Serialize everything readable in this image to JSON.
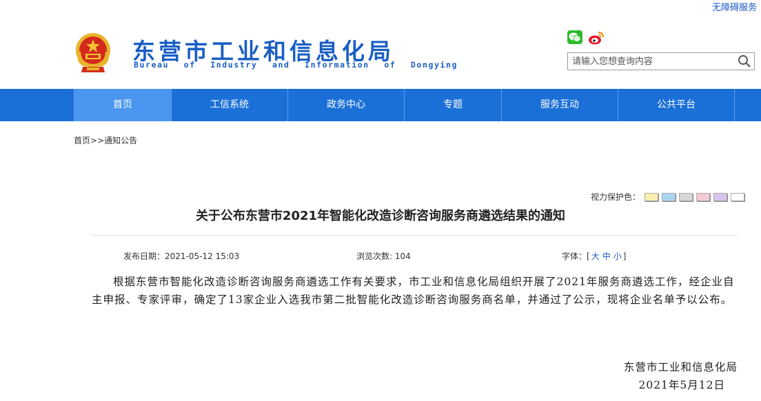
{
  "accessibility_link": "无障碍服务",
  "header": {
    "site_title_cn": "东营市工业和信息化局",
    "site_title_en": "Bureau of Industry and Information of Dongying",
    "search": {
      "placeholder": "请输入您想查询内容",
      "value": ""
    }
  },
  "nav": {
    "items": [
      {
        "label": "首页",
        "active": true
      },
      {
        "label": "工信系统"
      },
      {
        "label": "政务中心"
      },
      {
        "label": "专题"
      },
      {
        "label": "服务互动"
      },
      {
        "label": "公共平台"
      }
    ]
  },
  "breadcrumb": {
    "home": "首页",
    "separator": ">>",
    "current": "通知公告"
  },
  "eye_protection": {
    "label": "视力保护色：",
    "colors": [
      "#f7efb0",
      "#a8d8f0",
      "#d8d8d8",
      "#f5cbd6",
      "#d7c4ef",
      "#ffffff"
    ]
  },
  "article": {
    "title": "关于公布东营市2021年智能化改造诊断咨询服务商遴选结果的通知",
    "publish_label": "发布日期：",
    "publish_date": "2021-05-12 15:03",
    "views_label": "浏览次数: ",
    "views": "104",
    "font_label": "字体：[",
    "font_large": "大",
    "font_medium": "中",
    "font_small": "小",
    "font_close": "]",
    "body": "根据东营市智能化改造诊断咨询服务商遴选工作有关要求，市工业和信息化局组织开展了2021年服务商遴选工作，经企业自主申报、专家评审，确定了13家企业入选我市第二批智能化改造诊断咨询服务商名单，并通过了公示，现将企业名单予以公布。",
    "signature": "东营市工业和信息化局",
    "sign_date": "2021年5月12日"
  },
  "colors": {
    "brand_blue": "#1a5fc4",
    "nav_bg": "#1b70d8",
    "nav_active": "#4a95f0"
  }
}
